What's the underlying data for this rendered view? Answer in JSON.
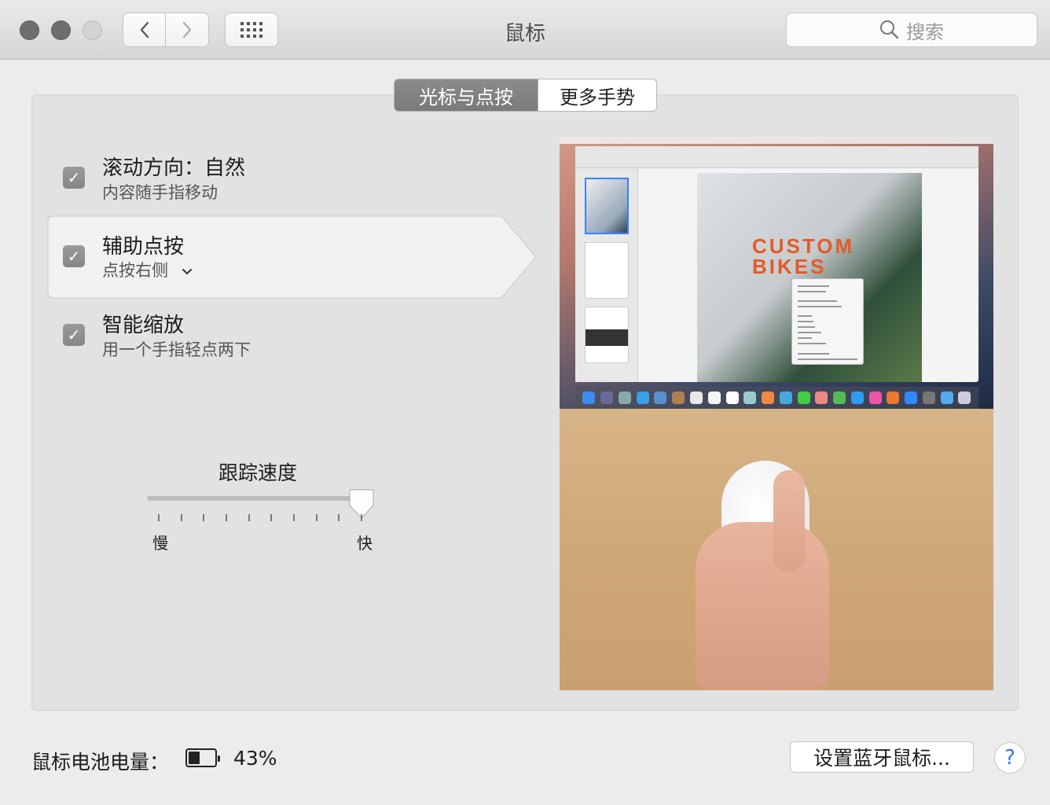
{
  "window": {
    "title": "鼠标",
    "search_placeholder": "搜索"
  },
  "tabs": [
    {
      "label": "光标与点按",
      "active": true
    },
    {
      "label": "更多手势",
      "active": false
    }
  ],
  "options": [
    {
      "title": "滚动方向：自然",
      "subtitle": "内容随手指移动",
      "checked": true
    },
    {
      "title": "辅助点按",
      "subtitle": "点按右侧",
      "checked": true,
      "has_dropdown": true
    },
    {
      "title": "智能缩放",
      "subtitle": "用一个手指轻点两下",
      "checked": true
    }
  ],
  "tracking": {
    "label": "跟踪速度",
    "min_label": "慢",
    "max_label": "快",
    "value_fraction": 0.96
  },
  "preview": {
    "doc_heading": "CUSTOM BIKES"
  },
  "battery": {
    "label": "鼠标电池电量：",
    "percent_text": "43%",
    "level": 0.43
  },
  "buttons": {
    "bluetooth": "设置蓝牙鼠标...",
    "help": "?"
  },
  "colors": {
    "accent_blue": "#2d7cf6",
    "preview_orange": "#e45a28"
  }
}
